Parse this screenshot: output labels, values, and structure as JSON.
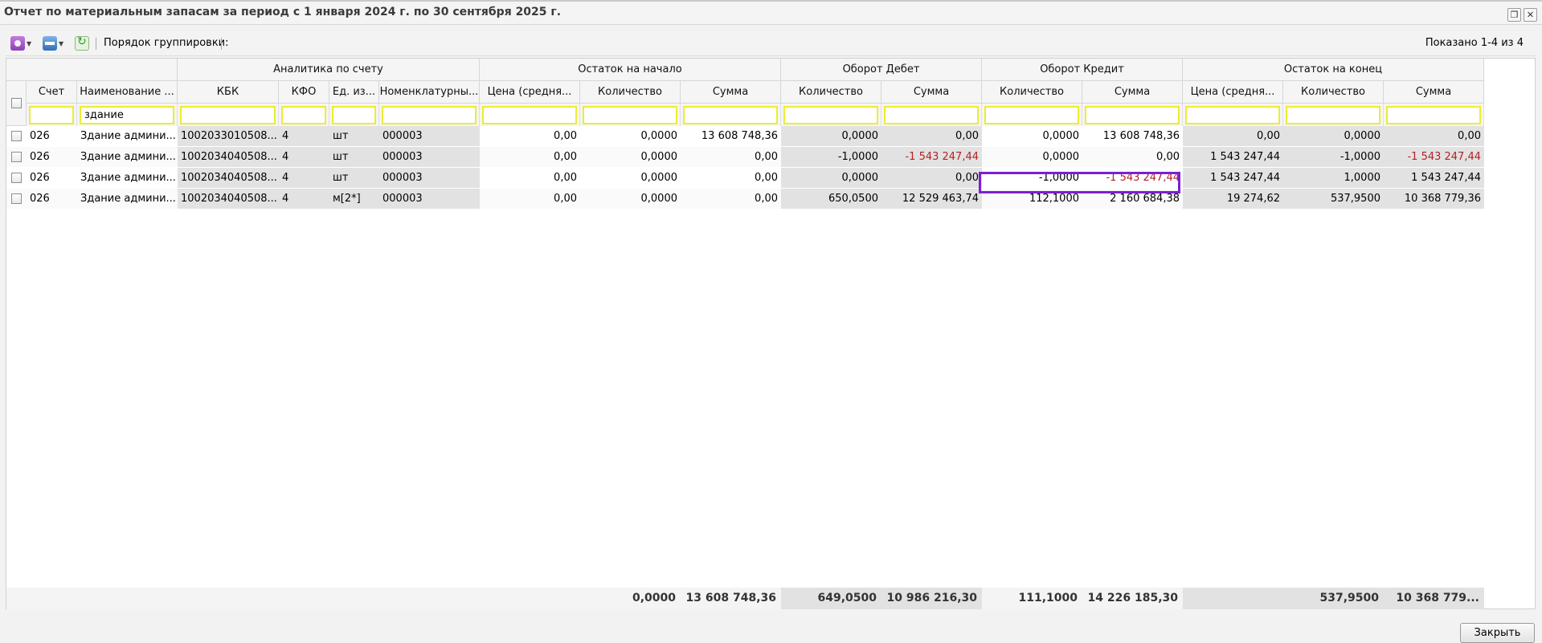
{
  "window": {
    "title": "Отчет по материальным запасам за период с 1 января 2024 г. по 30 сентября 2025 г.",
    "restore_icon": "restore-icon",
    "close_icon": "close-icon"
  },
  "toolbar": {
    "grouping_label": "Порядок группировки:",
    "shown_text": "Показано 1-4 из 4"
  },
  "group_headers": {
    "analytics": "Аналитика по счету",
    "start_balance": "Остаток на начало",
    "debit": "Оборот Дебет",
    "credit": "Оборот Кредит",
    "end_balance": "Остаток на конец"
  },
  "columns": {
    "schet": "Счет",
    "name": "Наименование ...",
    "kbk": "КБК",
    "kfo": "КФО",
    "unit": "Ед. из...",
    "nomen": "Номенклатурны...",
    "start_price": "Цена (средня...",
    "start_qty": "Количество",
    "start_sum": "Сумма",
    "debit_qty": "Количество",
    "debit_sum": "Сумма",
    "credit_qty": "Количество",
    "credit_sum": "Сумма",
    "end_price": "Цена (средня...",
    "end_qty": "Количество",
    "end_sum": "Сумма"
  },
  "filters": {
    "name_value": "здание"
  },
  "rows": [
    {
      "schet": "026",
      "name": "Здание админи...",
      "kbk": "1002033010508...",
      "kfo": "4",
      "unit": "шт",
      "nomen": "000003",
      "start_price": "0,00",
      "start_qty": "0,0000",
      "start_sum": "13 608 748,36",
      "debit_qty": "0,0000",
      "debit_sum": "0,00",
      "credit_qty": "0,0000",
      "credit_sum": "13 608 748,36",
      "end_price": "0,00",
      "end_qty": "0,0000",
      "end_sum": "0,00"
    },
    {
      "schet": "026",
      "name": "Здание админи...",
      "kbk": "1002034040508...",
      "kfo": "4",
      "unit": "шт",
      "nomen": "000003",
      "start_price": "0,00",
      "start_qty": "0,0000",
      "start_sum": "0,00",
      "debit_qty": "-1,0000",
      "debit_sum": "-1 543 247,44",
      "credit_qty": "0,0000",
      "credit_sum": "0,00",
      "end_price": "1 543 247,44",
      "end_qty": "-1,0000",
      "end_sum": "-1 543 247,44"
    },
    {
      "schet": "026",
      "name": "Здание админи...",
      "kbk": "1002034040508...",
      "kfo": "4",
      "unit": "шт",
      "nomen": "000003",
      "start_price": "0,00",
      "start_qty": "0,0000",
      "start_sum": "0,00",
      "debit_qty": "0,0000",
      "debit_sum": "0,00",
      "credit_qty": "-1,0000",
      "credit_sum": "-1 543 247,44",
      "end_price": "1 543 247,44",
      "end_qty": "1,0000",
      "end_sum": "1 543 247,44"
    },
    {
      "schet": "026",
      "name": "Здание админи...",
      "kbk": "1002034040508...",
      "kfo": "4",
      "unit": "м[2*]",
      "nomen": "000003",
      "start_price": "0,00",
      "start_qty": "0,0000",
      "start_sum": "0,00",
      "debit_qty": "650,0500",
      "debit_sum": "12 529 463,74",
      "credit_qty": "112,1000",
      "credit_sum": "2 160 684,38",
      "end_price": "19 274,62",
      "end_qty": "537,9500",
      "end_sum": "10 368 779,36"
    }
  ],
  "totals": {
    "start_qty": "0,0000",
    "start_sum": "13 608 748,36",
    "debit_qty": "649,0500",
    "debit_sum": "10 986 216,30",
    "credit_qty": "111,1000",
    "credit_sum": "14 226 185,30",
    "end_qty": "537,9500",
    "end_sum": "10 368 779..."
  },
  "buttons": {
    "close": "Закрыть"
  },
  "colors": {
    "negative": "#b22222",
    "selection": "#7b1fd8",
    "filter_border": "#ecec35"
  }
}
